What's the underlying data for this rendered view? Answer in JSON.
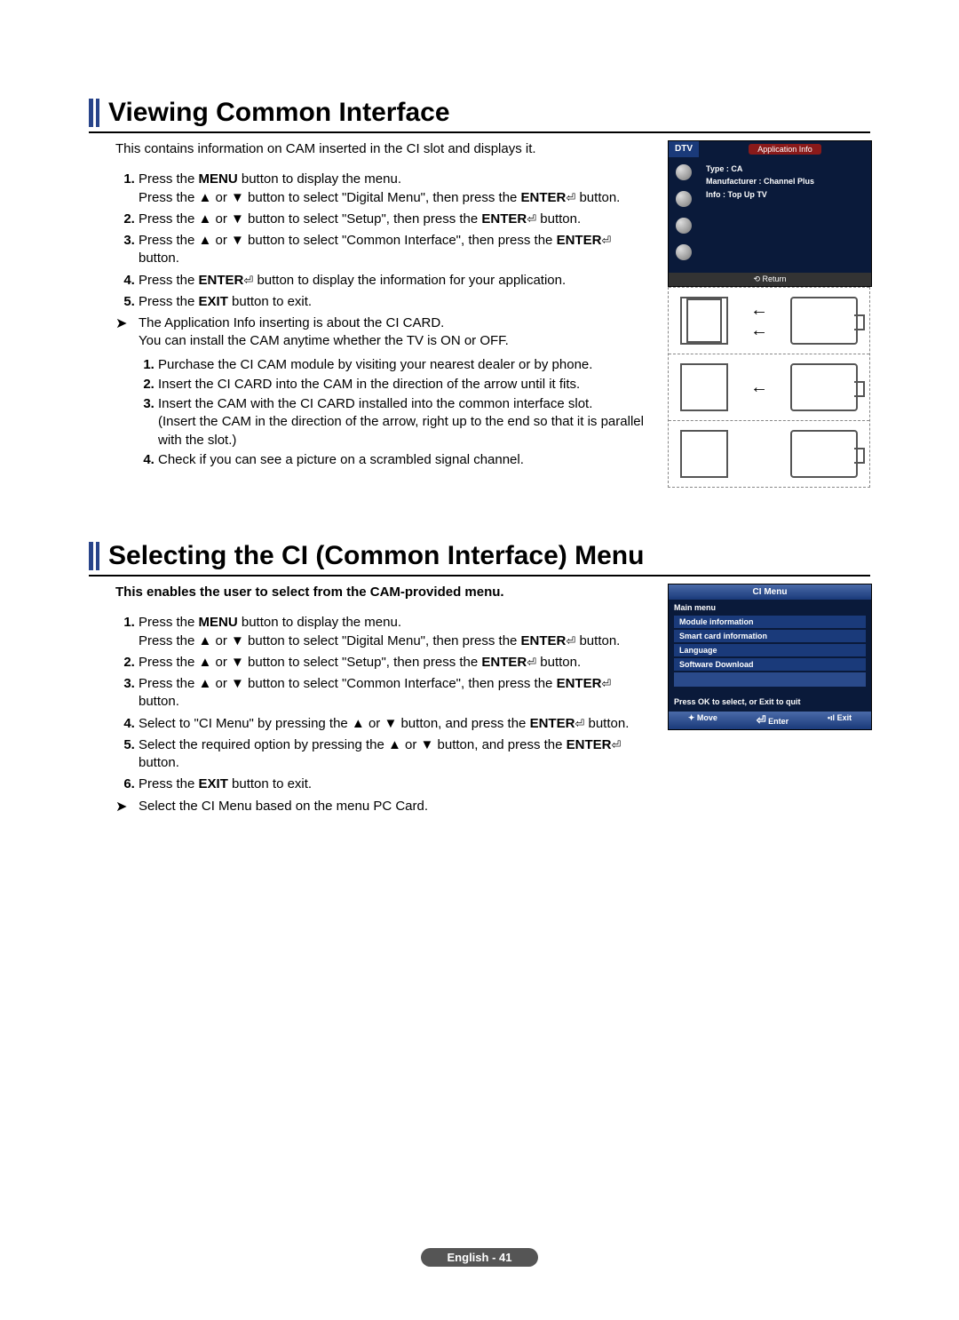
{
  "footer": "English - 41",
  "section1": {
    "title": "Viewing Common Interface",
    "intro": "This contains information on CAM inserted in the CI slot and displays it.",
    "steps": [
      {
        "pre": "Press the ",
        "b1": "MENU",
        "mid": " button to display the menu.\nPress the ▲ or ▼ button to select \"Digital Menu\", then press the ",
        "b2": "ENTER",
        "post": " button."
      },
      {
        "pre": "Press the ▲ or ▼ button to select \"Setup\", then press the ",
        "b1": "ENTER",
        "post": " button."
      },
      {
        "pre": "Press the ▲ or ▼ button to select \"Common Interface\", then press the ",
        "b1": "ENTER",
        "post": " button."
      },
      {
        "pre": "Press the ",
        "b1": "ENTER",
        "post": " button to display the information for your application."
      },
      {
        "pre": "Press the ",
        "b1": "EXIT",
        "post": " button to exit."
      }
    ],
    "note": "The Application Info inserting is about the CI CARD.\nYou can install the CAM anytime whether the TV is ON or OFF.",
    "sublist": [
      "Purchase the CI CAM module by visiting your nearest dealer or by phone.",
      "Insert the CI CARD into the CAM in the direction of the arrow until it fits.",
      "Insert the CAM with the CI CARD installed into the common interface slot.\n(Insert the CAM in the direction of the arrow, right up to the end so that it is parallel with the slot.)",
      "Check if you can see a picture on a scrambled signal channel."
    ],
    "dtv": {
      "tag": "DTV",
      "title": "Application Info",
      "lines": [
        "Type : CA",
        "Manufacturer : Channel Plus",
        "Info : Top Up TV"
      ],
      "return": "Return"
    }
  },
  "section2": {
    "title": "Selecting the CI (Common Interface) Menu",
    "intro": "This enables the user to select from the CAM-provided menu.",
    "steps": [
      {
        "pre": "Press the ",
        "b1": "MENU",
        "mid": " button to display the menu.\nPress the ▲ or ▼ button to select \"Digital Menu\", then press the ",
        "b2": "ENTER",
        "post": " button."
      },
      {
        "pre": "Press the ▲ or ▼ button to select \"Setup\", then press the ",
        "b1": "ENTER",
        "post": " button."
      },
      {
        "pre": "Press the ▲ or ▼ button to select \"Common Interface\", then press the ",
        "b1": "ENTER",
        "post": " button."
      },
      {
        "pre": "Select to \"CI Menu\" by pressing the ▲ or ▼ button, and press the ",
        "b1": "ENTER",
        "post": " button."
      },
      {
        "pre": "Select the required option by pressing the ▲ or ▼ button, and press the ",
        "b1": "ENTER",
        "post": " button."
      },
      {
        "pre": "Press the ",
        "b1": "EXIT",
        "post": " button to exit."
      }
    ],
    "note": "Select the CI Menu based on the menu PC Card.",
    "ci": {
      "title": "CI Menu",
      "sub": "Main menu",
      "items": [
        "Module information",
        "Smart card information",
        "Language",
        "Software Download"
      ],
      "prompt": "Press OK to select, or Exit to quit",
      "footer": {
        "move": "Move",
        "enter": "Enter",
        "exit": "Exit"
      }
    }
  },
  "icons": {
    "enter": "⏎"
  }
}
